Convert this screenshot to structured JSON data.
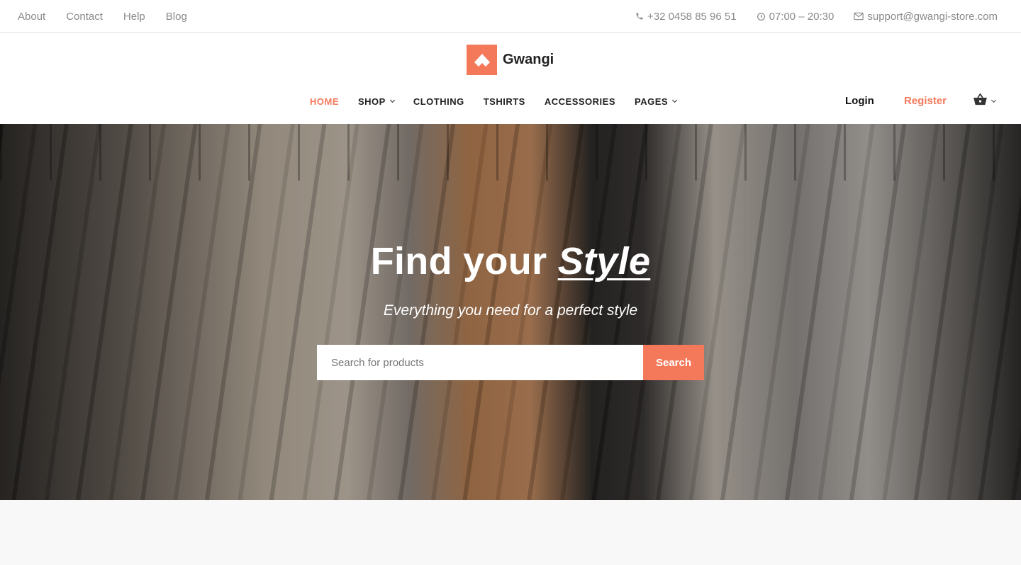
{
  "topbar": {
    "links": [
      "About",
      "Contact",
      "Help",
      "Blog"
    ],
    "phone": "+32 0458 85 96 51",
    "hours": "07:00 – 20:30",
    "email": "support@gwangi-store.com"
  },
  "header": {
    "brand": "Gwangi",
    "nav": [
      {
        "label": "HOME",
        "active": true,
        "dropdown": false
      },
      {
        "label": "SHOP",
        "active": false,
        "dropdown": true
      },
      {
        "label": "CLOTHING",
        "active": false,
        "dropdown": false
      },
      {
        "label": "TSHIRTS",
        "active": false,
        "dropdown": false
      },
      {
        "label": "ACCESSORIES",
        "active": false,
        "dropdown": false
      },
      {
        "label": "PAGES",
        "active": false,
        "dropdown": true
      }
    ],
    "login": "Login",
    "register": "Register",
    "cart_icon": "basket-icon"
  },
  "hero": {
    "title_prefix": "Find your ",
    "title_accent": "Style",
    "subtitle": "Everything you need for a perfect style",
    "search_placeholder": "Search for products",
    "search_button": "Search"
  },
  "colors": {
    "accent": "#f4795b",
    "text": "#222222",
    "muted": "#8a8a8a"
  }
}
